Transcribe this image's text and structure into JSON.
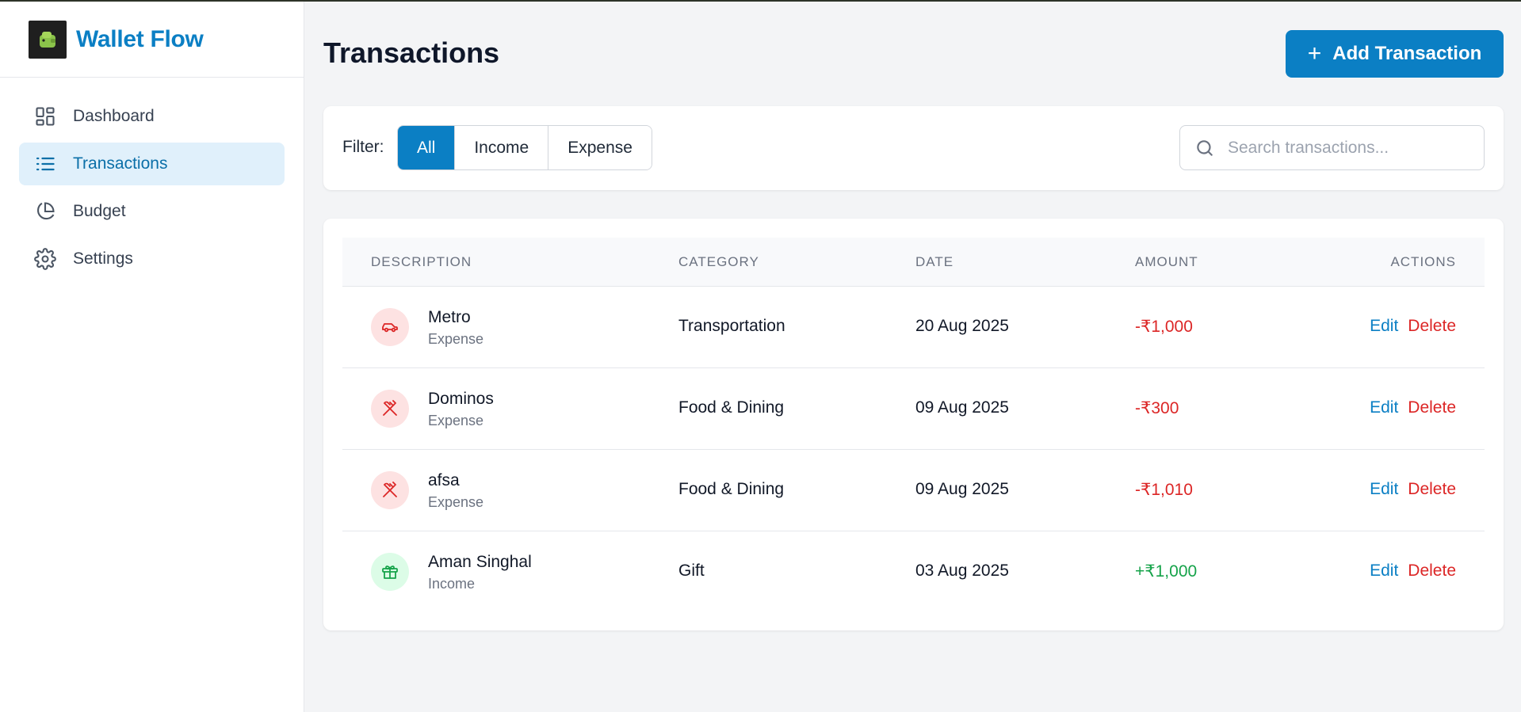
{
  "app": {
    "name": "Wallet Flow"
  },
  "sidebar": {
    "items": [
      {
        "label": "Dashboard",
        "icon": "dashboard-grid-icon",
        "active": false
      },
      {
        "label": "Transactions",
        "icon": "list-icon",
        "active": true
      },
      {
        "label": "Budget",
        "icon": "pie-chart-icon",
        "active": false
      },
      {
        "label": "Settings",
        "icon": "gear-icon",
        "active": false
      }
    ]
  },
  "header": {
    "title": "Transactions",
    "add_button_label": "Add Transaction"
  },
  "filter": {
    "label": "Filter:",
    "options": [
      "All",
      "Income",
      "Expense"
    ],
    "selected": "All"
  },
  "search": {
    "placeholder": "Search transactions...",
    "value": ""
  },
  "table": {
    "columns": [
      "DESCRIPTION",
      "CATEGORY",
      "DATE",
      "AMOUNT",
      "ACTIONS"
    ],
    "rows": [
      {
        "name": "Metro",
        "type": "Expense",
        "icon": "car-icon",
        "category": "Transportation",
        "date": "20 Aug 2025",
        "amount": "-₹1,000",
        "edit": "Edit",
        "delete": "Delete"
      },
      {
        "name": "Dominos",
        "type": "Expense",
        "icon": "utensils-icon",
        "category": "Food & Dining",
        "date": "09 Aug 2025",
        "amount": "-₹300",
        "edit": "Edit",
        "delete": "Delete"
      },
      {
        "name": "afsa",
        "type": "Expense",
        "icon": "utensils-icon",
        "category": "Food & Dining",
        "date": "09 Aug 2025",
        "amount": "-₹1,010",
        "edit": "Edit",
        "delete": "Delete"
      },
      {
        "name": "Aman Singhal",
        "type": "Income",
        "icon": "gift-icon",
        "category": "Gift",
        "date": "03 Aug 2025",
        "amount": "+₹1,000",
        "edit": "Edit",
        "delete": "Delete"
      }
    ]
  },
  "colors": {
    "brand": "#0b7fc4",
    "expense": "#dc2626",
    "income": "#16a34a",
    "active_nav_bg": "#e0f0fb"
  }
}
